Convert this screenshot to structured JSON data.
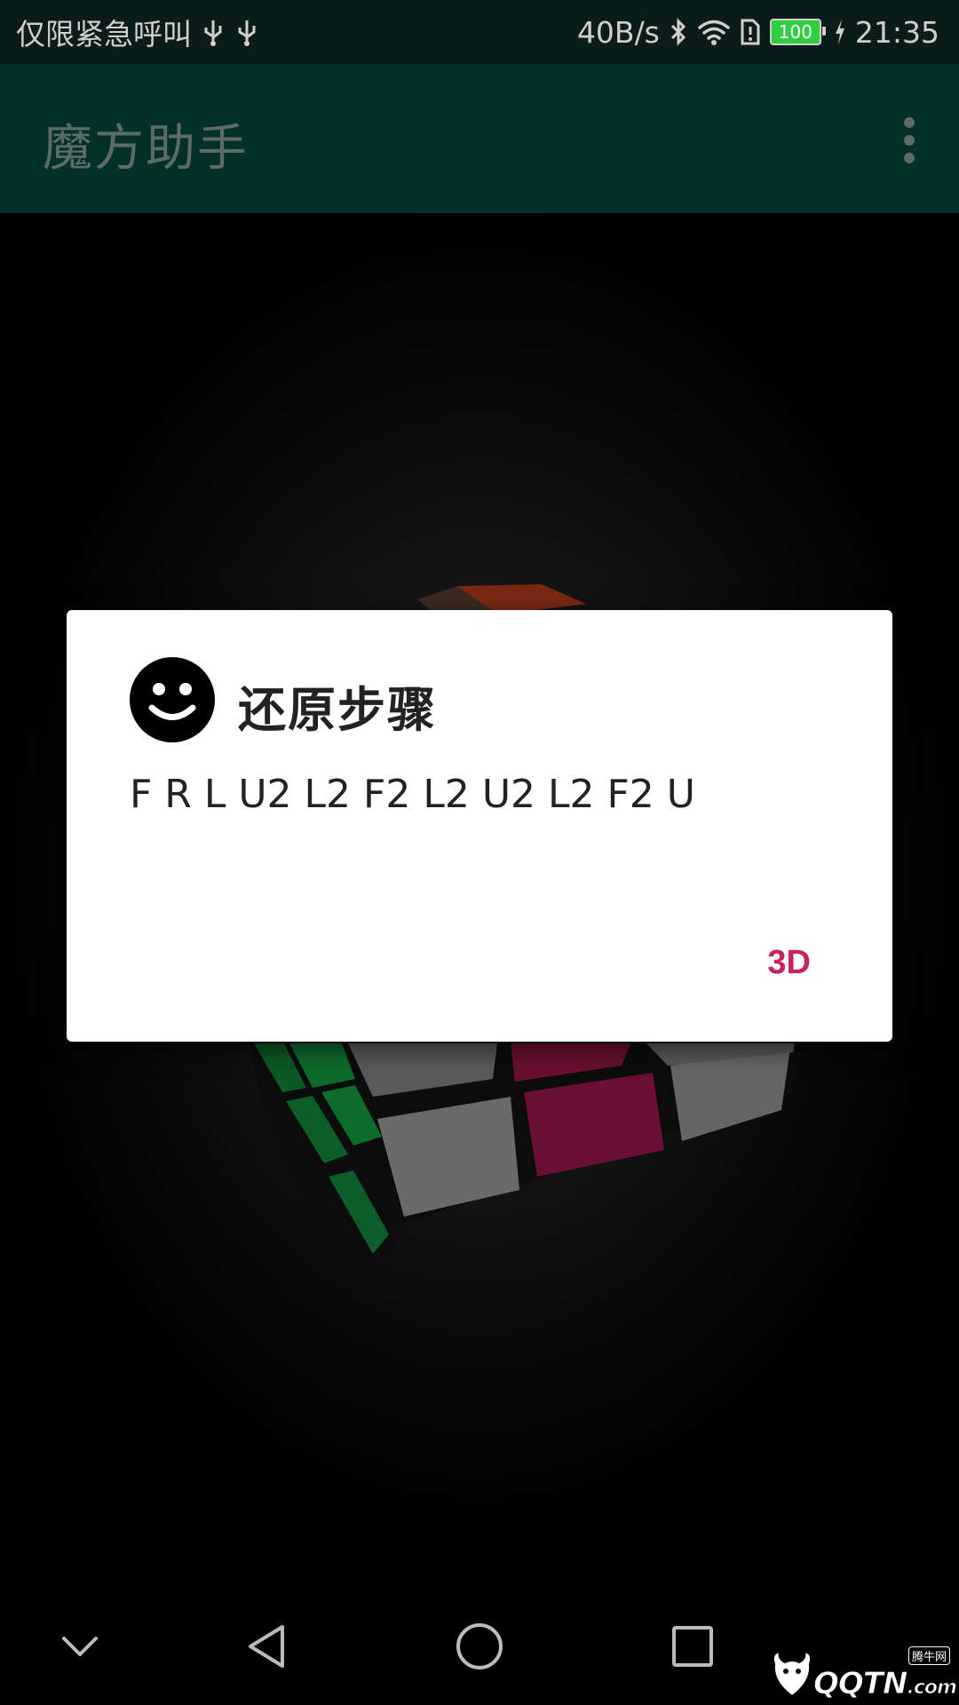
{
  "status_bar": {
    "carrier": "仅限紧急呼叫",
    "net_speed": "40B/s",
    "battery": "100",
    "time": "21:35"
  },
  "app_bar": {
    "title": "魔方助手"
  },
  "dialog": {
    "title": "还原步骤",
    "message": "F R L U2 L2 F2 L2 U2 L2 F2 U",
    "button_label": "3D"
  },
  "watermark": {
    "brand": "QQTN",
    "suffix": ".com",
    "small": "腾牛网"
  },
  "colors": {
    "accent": "#c9235f",
    "app_bar": "#033029",
    "status_bar": "#0c1c19"
  }
}
